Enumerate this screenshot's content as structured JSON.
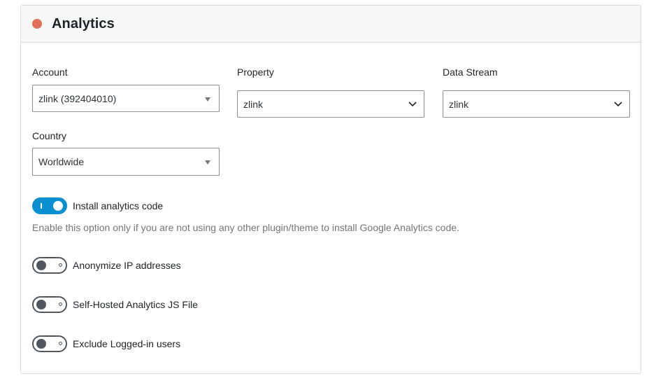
{
  "panel": {
    "title": "Analytics",
    "status_color": "#e26f56"
  },
  "fields": {
    "account": {
      "label": "Account",
      "value": "zlink (392404010)"
    },
    "property": {
      "label": "Property",
      "value": "zlink"
    },
    "data_stream": {
      "label": "Data Stream",
      "value": "zlink"
    },
    "country": {
      "label": "Country",
      "value": "Worldwide"
    }
  },
  "toggles": {
    "install_code": {
      "label": "Install analytics code",
      "on": true
    },
    "install_help": "Enable this option only if you are not using any other plugin/theme to install Google Analytics code.",
    "anonymize_ip": {
      "label": "Anonymize IP addresses",
      "on": false
    },
    "self_hosted_js": {
      "label": "Self-Hosted Analytics JS File",
      "on": false
    },
    "exclude_logged_in": {
      "label": "Exclude Logged-in users",
      "on": false
    }
  },
  "colors": {
    "accent": "#0a8fd1",
    "toggle_off": "#50575e"
  }
}
